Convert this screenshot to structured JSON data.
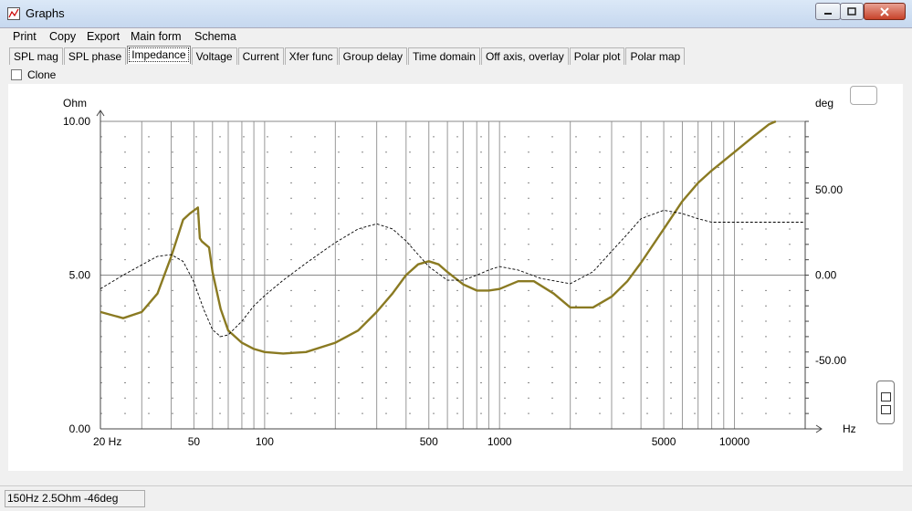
{
  "window": {
    "title": "Graphs"
  },
  "menu": [
    "Print",
    "Copy",
    "Export",
    "Main form",
    "Schema"
  ],
  "tabs": [
    "SPL mag",
    "SPL phase",
    "Impedance",
    "Voltage",
    "Current",
    "Xfer func",
    "Group delay",
    "Time domain",
    "Off axis, overlay",
    "Polar plot",
    "Polar map"
  ],
  "active_tab": "Impedance",
  "clone": {
    "label": "Clone",
    "checked": false
  },
  "status": {
    "text": "150Hz 2.5Ohm -46deg"
  },
  "colors": {
    "impedance": "#8a7a22",
    "phase": "#000000",
    "grid": "#999999"
  },
  "chart_data": {
    "type": "line",
    "xscale": "log",
    "xlim": [
      20,
      20000
    ],
    "xticks": [
      20,
      50,
      100,
      500,
      1000,
      5000,
      10000
    ],
    "xtick_labels": [
      "20 Hz",
      "50",
      "100",
      "500",
      "1000",
      "5000",
      "10000"
    ],
    "xlabel": "Hz",
    "ylabel_left": "Ohm",
    "ylim_left": [
      0,
      10
    ],
    "yticks_left": [
      0,
      5,
      10
    ],
    "ytick_labels_left": [
      "0.00",
      "5.00",
      "10.00"
    ],
    "ylabel_right": "deg",
    "ylim_right": [
      -90,
      90
    ],
    "yticks_right": [
      -50,
      0,
      50
    ],
    "ytick_labels_right": [
      "-50.00",
      "0.00",
      "50.00"
    ],
    "grid": true,
    "series": [
      {
        "style": "solid",
        "axis": "left",
        "x": [
          20,
          25,
          30,
          35,
          40,
          45,
          48,
          50,
          52,
          53,
          54,
          58,
          60,
          65,
          70,
          80,
          90,
          100,
          120,
          150,
          200,
          250,
          300,
          350,
          400,
          450,
          500,
          550,
          600,
          700,
          800,
          900,
          1000,
          1200,
          1400,
          1700,
          2000,
          2500,
          3000,
          3500,
          4000,
          5000,
          6000,
          7000,
          8000,
          10000,
          12000,
          14000,
          15000
        ],
        "y": [
          3.8,
          3.6,
          3.8,
          4.4,
          5.6,
          6.8,
          7.0,
          7.1,
          7.2,
          6.2,
          6.1,
          5.9,
          5.1,
          3.9,
          3.2,
          2.8,
          2.6,
          2.5,
          2.45,
          2.5,
          2.8,
          3.2,
          3.8,
          4.4,
          5.0,
          5.35,
          5.45,
          5.35,
          5.1,
          4.7,
          4.5,
          4.5,
          4.55,
          4.8,
          4.8,
          4.4,
          3.95,
          3.95,
          4.3,
          4.8,
          5.4,
          6.5,
          7.4,
          8.0,
          8.4,
          9.0,
          9.5,
          9.9,
          10.0
        ]
      },
      {
        "style": "dashed",
        "axis": "right",
        "x": [
          20,
          25,
          30,
          35,
          40,
          45,
          50,
          55,
          60,
          65,
          70,
          80,
          90,
          100,
          120,
          150,
          200,
          250,
          300,
          350,
          400,
          500,
          600,
          700,
          800,
          900,
          1000,
          1200,
          1500,
          2000,
          2500,
          3000,
          3500,
          4000,
          5000,
          6000,
          7000,
          8000,
          10000,
          12000,
          15000,
          20000
        ],
        "y": [
          -8,
          0,
          6,
          11,
          12,
          8,
          -4,
          -20,
          -32,
          -36,
          -35,
          -27,
          -18,
          -12,
          -3,
          7,
          19,
          27,
          30,
          27,
          20,
          5,
          -3,
          -3,
          0,
          3,
          5,
          3,
          -2,
          -5,
          2,
          14,
          24,
          33,
          38,
          36,
          33,
          31,
          31,
          31,
          31,
          31
        ]
      }
    ]
  }
}
